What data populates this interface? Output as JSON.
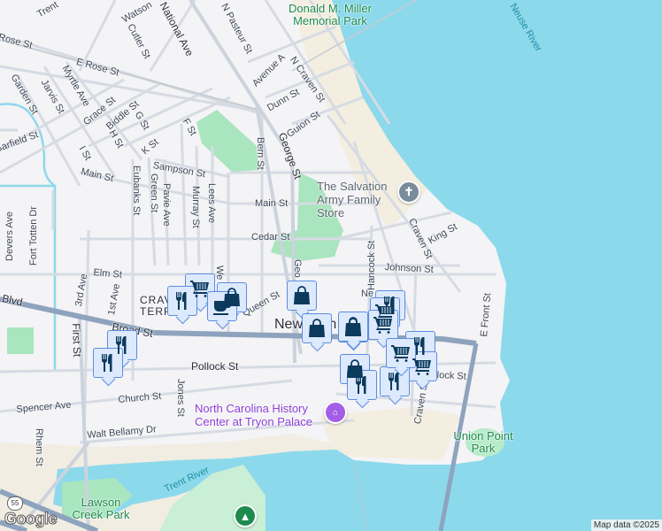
{
  "map": {
    "colors": {
      "water": "#8cd9ec",
      "land": "#f4f3f5",
      "park": "#a9e5be",
      "sand": "#f3eee0",
      "road": "#d5dbe3",
      "arterial": "#8ea3bd",
      "marker_fill": "#dde9fc",
      "marker_border": "#5b8de0",
      "marker_icon": "#0b3a5c"
    },
    "streets": [
      "Trent",
      "Watson",
      "Rose St",
      "E Rose St",
      "Cutler St",
      "National Ave",
      "N Pasteur St",
      "Avenue A",
      "N Craven St",
      "Dunn St",
      "Guion St",
      "Garden St",
      "Jarvis St",
      "Myrtle Ave",
      "Grace St",
      "Biddle St",
      "G St",
      "F St",
      "H St",
      "K St",
      "I St",
      "Garfield St",
      "Bern St",
      "George St",
      "Sampson St",
      "Main St",
      "Main St",
      "Eubanks St",
      "Green St",
      "Pavie Ave",
      "Murray St",
      "Lees Ave",
      "Cedar St",
      "Devers Ave",
      "Fort Totten Dr",
      "Elm St",
      "3rd Ave",
      "1st Ave",
      "First St",
      "Broad St",
      "Blvd",
      "Pollock St",
      "Church St",
      "Jones St",
      "Spencer Ave",
      "Walt Bellamy Dr",
      "Rhem St",
      "Hancock St",
      "Johnson St",
      "Craven St",
      "King St",
      "E Front St",
      "Craven St",
      "lock St",
      "Queen St",
      "We",
      "Geo",
      "Ne"
    ],
    "places": {
      "park1": "Donald M. Miller Memorial Park",
      "salvation": "The Salvation Army Family Store",
      "history": "North Carolina History Center at Tryon Palace",
      "union": "Union Point Park",
      "lawson": "Lawson Creek Park",
      "neuse": "Neuse River",
      "trent": "Trent River",
      "crav": "CRAVEN TERRACE",
      "newbern": "New Bern"
    },
    "highway_shield": "55",
    "markers": [
      "restaurant",
      "grocery",
      "shopping",
      "coffee",
      "shopping",
      "shopping",
      "shopping",
      "restaurant",
      "restaurant",
      "restaurant",
      "grocery",
      "grocery",
      "shopping",
      "restaurant",
      "shopping",
      "grocery",
      "restaurant",
      "restaurant",
      "grocery"
    ],
    "logo": "Google",
    "attribution": "Map data ©2025"
  }
}
